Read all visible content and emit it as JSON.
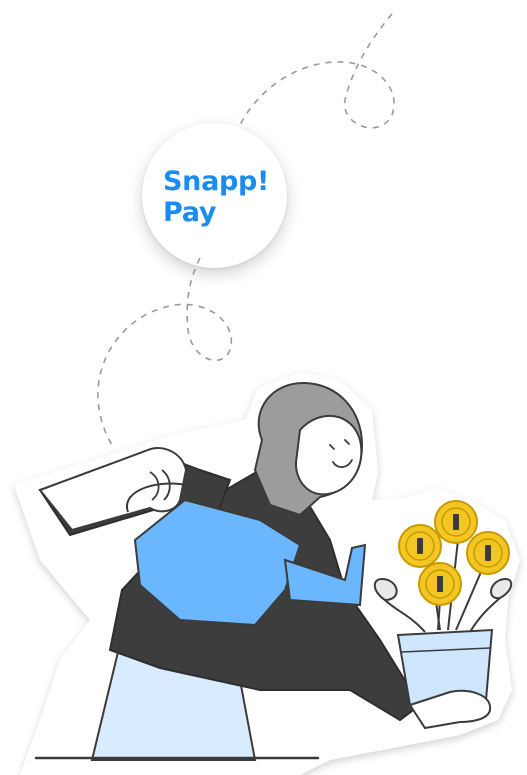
{
  "logo": {
    "line1": "Snapp!",
    "line2": "Pay",
    "brand_color": "#1a8cf0"
  },
  "illustration": {
    "subject": "person-watering-coin-plant",
    "icons": [
      "watering-can-icon",
      "coin-plant-icon",
      "coin-icon"
    ],
    "colors": {
      "outline": "#3b3b3b",
      "body": "#3d3d3d",
      "scarf": "#9c9c9c",
      "can": "#6ab6ff",
      "pot": "#cfe6ff",
      "skirt": "#d9ecff",
      "coin": "#f2c623",
      "coin_edge": "#c99a00",
      "leaf": "#e9e9e9"
    }
  }
}
